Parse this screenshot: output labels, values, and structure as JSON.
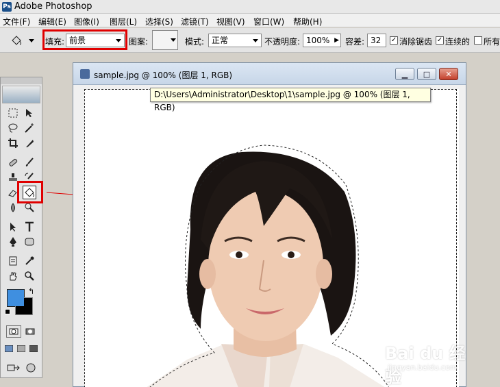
{
  "app": {
    "title": "Adobe Photoshop"
  },
  "menu": [
    "文件(F)",
    "编辑(E)",
    "图像(I)",
    "图层(L)",
    "选择(S)",
    "滤镜(T)",
    "视图(V)",
    "窗口(W)",
    "帮助(H)"
  ],
  "options": {
    "fill_label": "填充:",
    "fill_value": "前景",
    "pattern_label": "图案:",
    "mode_label": "模式:",
    "mode_value": "正常",
    "opacity_label": "不透明度:",
    "opacity_value": "100%",
    "tolerance_label": "容差:",
    "tolerance_value": "32",
    "antialias_label": "消除锯齿",
    "contiguous_label": "连续的",
    "all_layers_label": "所有"
  },
  "document": {
    "title": "sample.jpg @ 100% (图层 1, RGB)",
    "tooltip": "D:\\Users\\Administrator\\Desktop\\1\\sample.jpg @ 100% (图层 1, RGB)"
  },
  "colors": {
    "foreground": "#3f8fe0",
    "background": "#000000",
    "highlight": "#e00000"
  },
  "tools": [
    "marquee-icon",
    "move-icon",
    "lasso-icon",
    "magic-wand-icon",
    "crop-icon",
    "slice-icon",
    "healing-icon",
    "brush-icon",
    "stamp-icon",
    "history-brush-icon",
    "eraser-icon",
    "paint-bucket-icon",
    "blur-icon",
    "dodge-icon",
    "path-select-icon",
    "type-icon",
    "pen-icon",
    "shape-icon",
    "notes-icon",
    "eyedropper-icon",
    "hand-icon",
    "zoom-icon"
  ],
  "watermark": {
    "brand": "Bai du 经验",
    "url": "jingyan.baidu.com"
  }
}
